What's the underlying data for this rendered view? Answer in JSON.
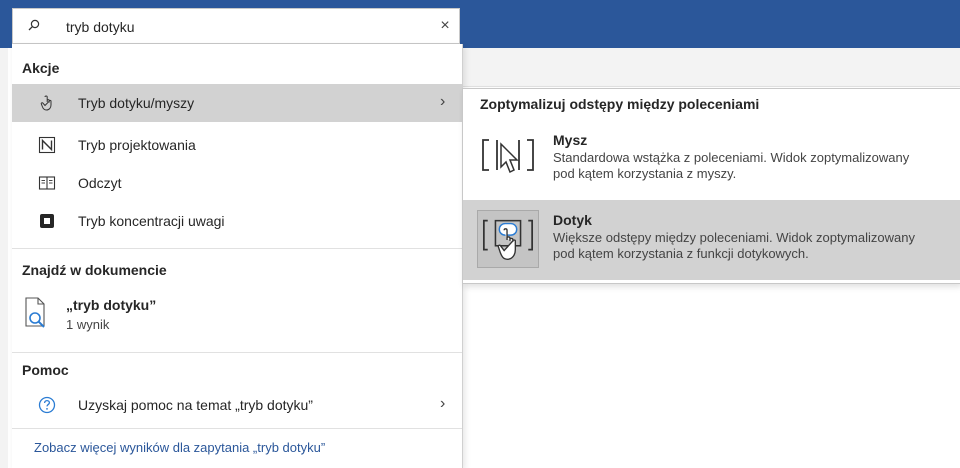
{
  "search": {
    "query": "tryb dotyku",
    "clear_glyph": "×"
  },
  "sections": {
    "actions_title": "Akcje",
    "find_title": "Znajdź w dokumencie",
    "help_title": "Pomoc"
  },
  "actions": [
    {
      "label": "Tryb dotyku/myszy",
      "icon": "touch-mouse-icon",
      "has_submenu": true,
      "selected": true
    },
    {
      "label": "Tryb projektowania",
      "icon": "design-mode-icon"
    },
    {
      "label": "Odczyt",
      "icon": "read-mode-icon"
    },
    {
      "label": "Tryb koncentracji uwagi",
      "icon": "focus-mode-icon"
    }
  ],
  "find": {
    "result_title": "„tryb dotyku”",
    "result_count": "1 wynik"
  },
  "help": {
    "label": "Uzyskaj pomoc na temat „tryb dotyku”"
  },
  "more_results": "Zobacz więcej wyników dla zapytania „tryb dotyku”",
  "chevron_glyph": "›",
  "submenu": {
    "title": "Zoptymalizuj odstępy między poleceniami",
    "options": [
      {
        "title": "Mysz",
        "desc_line1": "Standardowa wstążka z poleceniami. Widok zoptymalizowany",
        "desc_line2": "pod kątem korzystania z myszy.",
        "icon": "mouse-mode-icon"
      },
      {
        "title": "Dotyk",
        "desc_line1": "Większe odstępy między poleceniami. Widok zoptymalizowany",
        "desc_line2": "pod kątem korzystania z funkcji dotykowych.",
        "icon": "touch-mode-icon",
        "selected": true
      }
    ]
  },
  "colors": {
    "titlebar": "#2b579a",
    "selected_row": "#d2d2d2",
    "link": "#2b579a",
    "help_icon": "#2b7cd3"
  }
}
